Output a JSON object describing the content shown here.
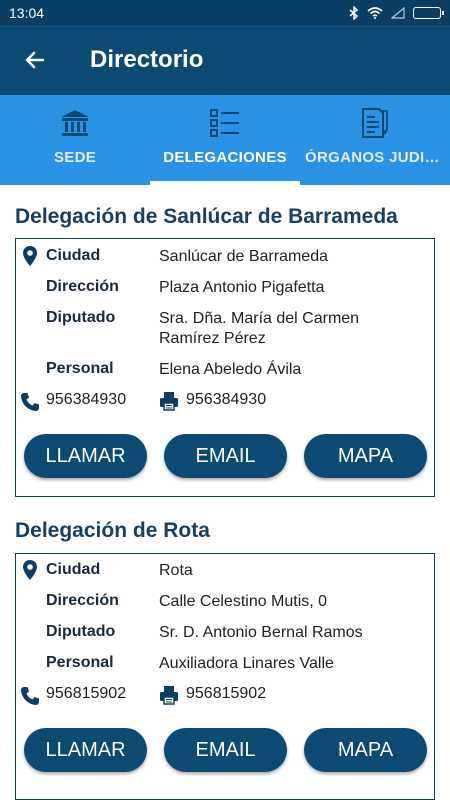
{
  "status_bar": {
    "time": "13:04"
  },
  "app_bar": {
    "title": "Directorio"
  },
  "tabs": [
    {
      "label": "SEDE",
      "icon": "bank-icon",
      "active": false
    },
    {
      "label": "DELEGACIONES",
      "icon": "list-icon",
      "active": true
    },
    {
      "label": "ÓRGANOS JUDICIALES",
      "icon": "document-icon",
      "active": false
    }
  ],
  "delegations": [
    {
      "title": "Delegación de Sanlúcar de Barrameda",
      "labels": {
        "city": "Ciudad",
        "address": "Dirección",
        "deputy": "Diputado",
        "staff": "Personal"
      },
      "city": "Sanlúcar de Barrameda",
      "address": "Plaza Antonio Pigafetta",
      "deputy": "Sra. Dña. María del Carmen Ramírez Pérez",
      "staff": "Elena Abeledo Ávila",
      "phone": "956384930",
      "fax": "956384930",
      "buttons": {
        "call": "LLAMAR",
        "email": "EMAIL",
        "map": "MAPA"
      }
    },
    {
      "title": "Delegación de Rota",
      "labels": {
        "city": "Ciudad",
        "address": "Dirección",
        "deputy": "Diputado",
        "staff": "Personal"
      },
      "city": "Rota",
      "address": "Calle Celestino Mutis, 0",
      "deputy": "Sr. D. Antonio Bernal Ramos",
      "staff": "Auxiliadora Linares Valle",
      "phone": "956815902",
      "fax": "956815902",
      "buttons": {
        "call": "LLAMAR",
        "email": "EMAIL",
        "map": "MAPA"
      }
    }
  ],
  "colors": {
    "primary_dark": "#0b4a73",
    "tab_bar": "#2b93e6",
    "title_text": "#173f5f"
  }
}
